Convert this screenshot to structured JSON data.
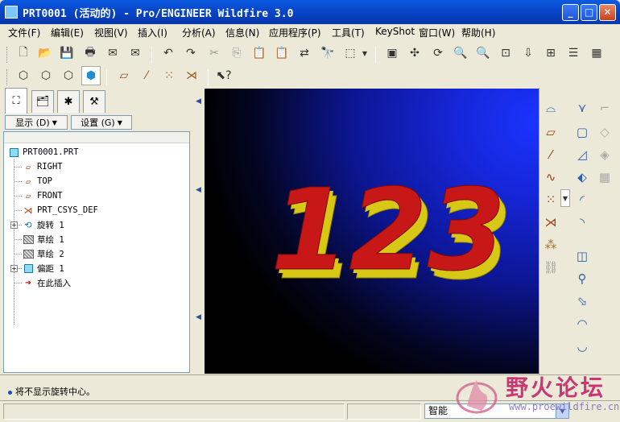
{
  "window": {
    "title": "PRT0001 (活动的) - Pro/ENGINEER Wildfire 3.0",
    "minimize": "_",
    "maximize": "□",
    "close": "✕"
  },
  "menu": [
    "文件(F)",
    "编辑(E)",
    "视图(V)",
    "插入(I)",
    "分析(A)",
    "信息(N)",
    "应用程序(P)",
    "工具(T)",
    "KeyShot",
    "窗口(W)",
    "帮助(H)"
  ],
  "model_tree": {
    "tabs": [
      "model-tree",
      "layers",
      "favorites",
      "properties"
    ],
    "display_button": "显示 (D)",
    "settings_button": "设置 (G)",
    "root": "PRT0001.PRT",
    "items": [
      {
        "label": "RIGHT",
        "icon": "datum-plane-icon",
        "expandable": false
      },
      {
        "label": "TOP",
        "icon": "datum-plane-icon",
        "expandable": false
      },
      {
        "label": "FRONT",
        "icon": "datum-plane-icon",
        "expandable": false
      },
      {
        "label": "PRT_CSYS_DEF",
        "icon": "csys-icon",
        "expandable": false
      },
      {
        "label": "旋转 1",
        "icon": "revolve-icon",
        "expandable": true
      },
      {
        "label": "草绘 1",
        "icon": "sketch-icon",
        "expandable": false
      },
      {
        "label": "草绘 2",
        "icon": "sketch-icon",
        "expandable": false
      },
      {
        "label": "偏距 1",
        "icon": "offset-icon",
        "expandable": true
      },
      {
        "label": "在此插入",
        "icon": "insert-here-arrow-icon",
        "expandable": false
      }
    ]
  },
  "viewport": {
    "model_text": "123",
    "face_color": "#d41a1a",
    "side_color": "#d7c815",
    "background_top": "#1a34ff",
    "background_bottom": "#000000"
  },
  "message": "将不显示旋转中心。",
  "status": {
    "filter_value": "智能"
  },
  "watermark": {
    "title": "野火论坛",
    "url": "www.proewildfire.cn"
  }
}
